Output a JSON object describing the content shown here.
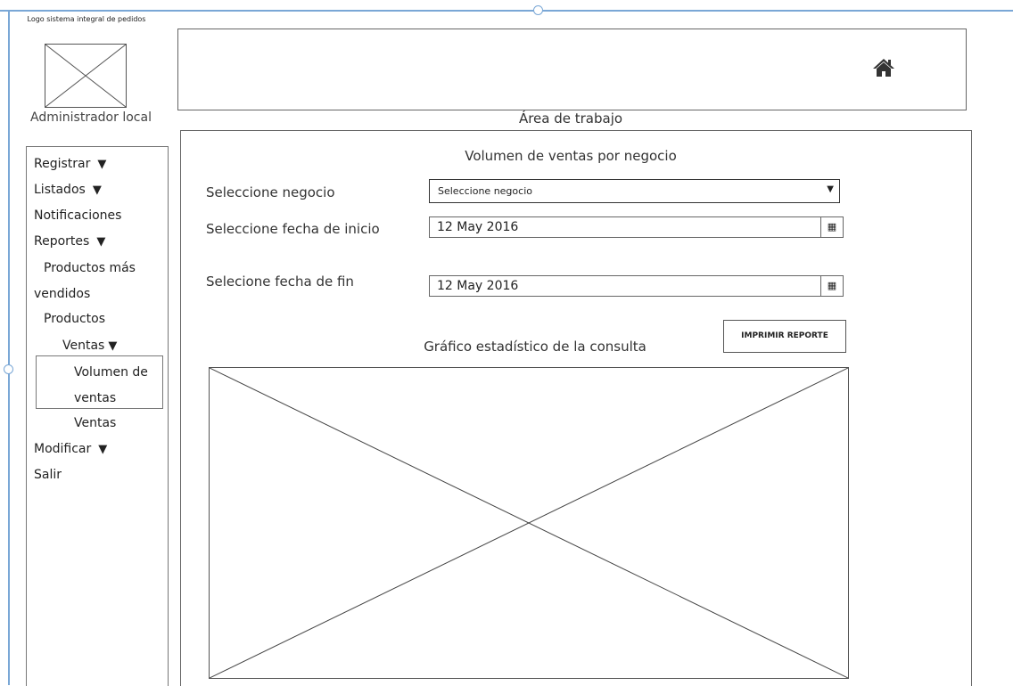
{
  "logo": {
    "caption": "Logo sistema integral de pedidos",
    "icon": "image-placeholder-icon"
  },
  "user": {
    "role_label": "Administrador local"
  },
  "header": {
    "home_icon": "home-icon"
  },
  "workspace": {
    "label": "Área de trabajo"
  },
  "sidebar": {
    "items": [
      {
        "label": "Registrar",
        "arrow": "▼"
      },
      {
        "label": "Listados",
        "arrow": "▼"
      },
      {
        "label": "Notificaciones"
      },
      {
        "label": "Reportes",
        "arrow": "▼"
      },
      {
        "label": "Productos más"
      },
      {
        "label": "vendidos"
      },
      {
        "label": "Productos"
      },
      {
        "label": "Ventas",
        "arrow": "▼"
      },
      {
        "label": "Volumen de"
      },
      {
        "label": "ventas"
      },
      {
        "label": "Ventas"
      },
      {
        "label": "Modificar",
        "arrow": "▼"
      },
      {
        "label": "Salir"
      }
    ]
  },
  "form": {
    "title": "Volumen de ventas por negocio",
    "business_label": "Seleccione negocio",
    "business_value": "Seleccione negocio",
    "start_label": "Seleccione fecha de inicio",
    "start_value": "12 May 2016",
    "end_label": "Selecione fecha de fin",
    "end_value": "12 May 2016",
    "print_label": "IMPRIMIR REPORTE"
  },
  "chart": {
    "title": "Gráfico estadístico de la consulta",
    "icon": "image-placeholder-icon"
  }
}
